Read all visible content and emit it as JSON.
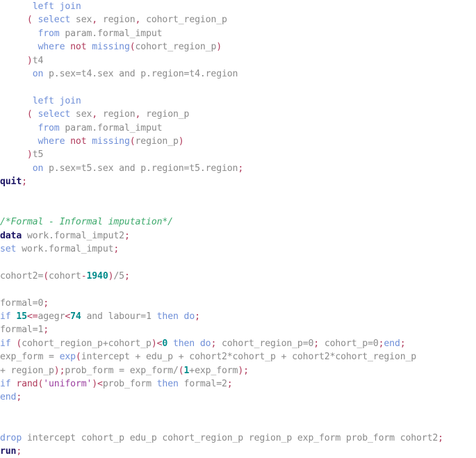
{
  "document": {
    "kind": "sas-code-listing",
    "language": "SAS",
    "background_color": "#ffffff"
  },
  "palette": {
    "plain": "#8a8a8a",
    "keyword": "#6f8fd8",
    "procedure": "#1b1464",
    "punctuation": "#b03a5b",
    "string": "#9b3fa0",
    "number": "#008b8b",
    "comment": "#3faa6d"
  },
  "code": {
    "lines": [
      {
        "id": "l01",
        "indent": 6,
        "tokens": [
          {
            "t": "kw",
            "v": "left join"
          }
        ]
      },
      {
        "id": "l02",
        "indent": 5,
        "tokens": [
          {
            "t": "punc",
            "v": "("
          },
          {
            "t": "plain",
            "v": " "
          },
          {
            "t": "kw",
            "v": "select"
          },
          {
            "t": "plain",
            "v": " sex"
          },
          {
            "t": "punc",
            "v": ","
          },
          {
            "t": "plain",
            "v": " region"
          },
          {
            "t": "punc",
            "v": ","
          },
          {
            "t": "plain",
            "v": " cohort_region_p"
          }
        ]
      },
      {
        "id": "l03",
        "indent": 7,
        "tokens": [
          {
            "t": "kw",
            "v": "from"
          },
          {
            "t": "plain",
            "v": " param.formal_imput"
          }
        ]
      },
      {
        "id": "l04",
        "indent": 7,
        "tokens": [
          {
            "t": "kw",
            "v": "where"
          },
          {
            "t": "plain",
            "v": " "
          },
          {
            "t": "func",
            "v": "not"
          },
          {
            "t": "plain",
            "v": " "
          },
          {
            "t": "kw",
            "v": "missing"
          },
          {
            "t": "punc",
            "v": "("
          },
          {
            "t": "plain",
            "v": "cohort_region_p"
          },
          {
            "t": "punc",
            "v": ")"
          }
        ]
      },
      {
        "id": "l05",
        "indent": 5,
        "tokens": [
          {
            "t": "punc",
            "v": ")"
          },
          {
            "t": "plain",
            "v": "t4"
          }
        ]
      },
      {
        "id": "l06",
        "indent": 6,
        "tokens": [
          {
            "t": "kw",
            "v": "on"
          },
          {
            "t": "plain",
            "v": " p.sex=t4.sex and p.region=t4.region"
          }
        ]
      },
      {
        "id": "l07",
        "indent": 0,
        "tokens": []
      },
      {
        "id": "l08",
        "indent": 6,
        "tokens": [
          {
            "t": "kw",
            "v": "left join"
          }
        ]
      },
      {
        "id": "l09",
        "indent": 5,
        "tokens": [
          {
            "t": "punc",
            "v": "("
          },
          {
            "t": "plain",
            "v": " "
          },
          {
            "t": "kw",
            "v": "select"
          },
          {
            "t": "plain",
            "v": " sex"
          },
          {
            "t": "punc",
            "v": ","
          },
          {
            "t": "plain",
            "v": " region"
          },
          {
            "t": "punc",
            "v": ","
          },
          {
            "t": "plain",
            "v": " region_p"
          }
        ]
      },
      {
        "id": "l10",
        "indent": 7,
        "tokens": [
          {
            "t": "kw",
            "v": "from"
          },
          {
            "t": "plain",
            "v": " param.formal_imput"
          }
        ]
      },
      {
        "id": "l11",
        "indent": 7,
        "tokens": [
          {
            "t": "kw",
            "v": "where"
          },
          {
            "t": "plain",
            "v": " "
          },
          {
            "t": "func",
            "v": "not"
          },
          {
            "t": "plain",
            "v": " "
          },
          {
            "t": "kw",
            "v": "missing"
          },
          {
            "t": "punc",
            "v": "("
          },
          {
            "t": "plain",
            "v": "region_p"
          },
          {
            "t": "punc",
            "v": ")"
          }
        ]
      },
      {
        "id": "l12",
        "indent": 5,
        "tokens": [
          {
            "t": "punc",
            "v": ")"
          },
          {
            "t": "plain",
            "v": "t5"
          }
        ]
      },
      {
        "id": "l13",
        "indent": 6,
        "tokens": [
          {
            "t": "kw",
            "v": "on"
          },
          {
            "t": "plain",
            "v": " p.sex=t5.sex and p.region=t5.region"
          },
          {
            "t": "punc",
            "v": ";"
          }
        ]
      },
      {
        "id": "l14",
        "indent": 0,
        "tokens": [
          {
            "t": "proc",
            "v": "quit"
          },
          {
            "t": "punc",
            "v": ";"
          }
        ]
      },
      {
        "id": "l15",
        "indent": 0,
        "tokens": []
      },
      {
        "id": "l16",
        "indent": 0,
        "tokens": []
      },
      {
        "id": "l17",
        "indent": 0,
        "tokens": [
          {
            "t": "cmt",
            "v": "/*Formal - Informal imputation*/"
          }
        ]
      },
      {
        "id": "l18",
        "indent": 0,
        "tokens": [
          {
            "t": "proc",
            "v": "data"
          },
          {
            "t": "plain",
            "v": " work.formal_imput2"
          },
          {
            "t": "punc",
            "v": ";"
          }
        ]
      },
      {
        "id": "l19",
        "indent": 0,
        "tokens": [
          {
            "t": "kw",
            "v": "set"
          },
          {
            "t": "plain",
            "v": " work.formal_imput"
          },
          {
            "t": "punc",
            "v": ";"
          }
        ]
      },
      {
        "id": "l20",
        "indent": 0,
        "tokens": []
      },
      {
        "id": "l21",
        "indent": 0,
        "tokens": [
          {
            "t": "plain",
            "v": "cohort2="
          },
          {
            "t": "punc",
            "v": "("
          },
          {
            "t": "plain",
            "v": "cohort"
          },
          {
            "t": "punc",
            "v": "-"
          },
          {
            "t": "num",
            "v": "1940"
          },
          {
            "t": "punc",
            "v": ")"
          },
          {
            "t": "plain",
            "v": "/5"
          },
          {
            "t": "punc",
            "v": ";"
          }
        ]
      },
      {
        "id": "l22",
        "indent": 0,
        "tokens": []
      },
      {
        "id": "l23",
        "indent": 0,
        "tokens": [
          {
            "t": "plain",
            "v": "formal=0"
          },
          {
            "t": "punc",
            "v": ";"
          }
        ]
      },
      {
        "id": "l24",
        "indent": 0,
        "tokens": [
          {
            "t": "kw",
            "v": "if"
          },
          {
            "t": "plain",
            "v": " "
          },
          {
            "t": "num",
            "v": "15"
          },
          {
            "t": "punc",
            "v": "<="
          },
          {
            "t": "plain",
            "v": "agegr"
          },
          {
            "t": "punc",
            "v": "<"
          },
          {
            "t": "num",
            "v": "74"
          },
          {
            "t": "plain",
            "v": " and labour=1 "
          },
          {
            "t": "kw",
            "v": "then"
          },
          {
            "t": "plain",
            "v": " "
          },
          {
            "t": "kw",
            "v": "do"
          },
          {
            "t": "punc",
            "v": ";"
          }
        ]
      },
      {
        "id": "l25",
        "indent": 0,
        "tokens": [
          {
            "t": "plain",
            "v": "formal=1"
          },
          {
            "t": "punc",
            "v": ";"
          }
        ]
      },
      {
        "id": "l26",
        "indent": 0,
        "tokens": [
          {
            "t": "kw",
            "v": "if"
          },
          {
            "t": "plain",
            "v": " "
          },
          {
            "t": "punc",
            "v": "("
          },
          {
            "t": "plain",
            "v": "cohort_region_p+cohort_p"
          },
          {
            "t": "punc",
            "v": ")<"
          },
          {
            "t": "num",
            "v": "0"
          },
          {
            "t": "plain",
            "v": " "
          },
          {
            "t": "kw",
            "v": "then"
          },
          {
            "t": "plain",
            "v": " "
          },
          {
            "t": "kw",
            "v": "do"
          },
          {
            "t": "punc",
            "v": ";"
          },
          {
            "t": "plain",
            "v": " cohort_region_p=0"
          },
          {
            "t": "punc",
            "v": ";"
          },
          {
            "t": "plain",
            "v": " cohort_p=0"
          },
          {
            "t": "punc",
            "v": ";"
          },
          {
            "t": "kw",
            "v": "end"
          },
          {
            "t": "punc",
            "v": ";"
          }
        ]
      },
      {
        "id": "l27",
        "indent": 0,
        "tokens": [
          {
            "t": "plain",
            "v": "exp_form = "
          },
          {
            "t": "kw",
            "v": "exp"
          },
          {
            "t": "punc",
            "v": "("
          },
          {
            "t": "plain",
            "v": "intercept + edu_p + cohort2*cohort_p + cohort2*cohort_region_p"
          }
        ]
      },
      {
        "id": "l28",
        "indent": 0,
        "tokens": [
          {
            "t": "plain",
            "v": "+ region_p"
          },
          {
            "t": "punc",
            "v": ");"
          },
          {
            "t": "plain",
            "v": "prob_form = exp_form/"
          },
          {
            "t": "punc",
            "v": "("
          },
          {
            "t": "num",
            "v": "1"
          },
          {
            "t": "plain",
            "v": "+exp_form"
          },
          {
            "t": "punc",
            "v": ");"
          }
        ]
      },
      {
        "id": "l29",
        "indent": 0,
        "tokens": [
          {
            "t": "kw",
            "v": "if"
          },
          {
            "t": "plain",
            "v": " "
          },
          {
            "t": "func",
            "v": "rand"
          },
          {
            "t": "punc",
            "v": "("
          },
          {
            "t": "str",
            "v": "'uniform'"
          },
          {
            "t": "punc",
            "v": ")<"
          },
          {
            "t": "plain",
            "v": "prob_form "
          },
          {
            "t": "kw",
            "v": "then"
          },
          {
            "t": "plain",
            "v": " formal=2"
          },
          {
            "t": "punc",
            "v": ";"
          }
        ]
      },
      {
        "id": "l30",
        "indent": 0,
        "tokens": [
          {
            "t": "kw",
            "v": "end"
          },
          {
            "t": "punc",
            "v": ";"
          }
        ]
      },
      {
        "id": "l31",
        "indent": 0,
        "tokens": []
      },
      {
        "id": "l32",
        "indent": 0,
        "tokens": []
      },
      {
        "id": "l33",
        "indent": 0,
        "tokens": [
          {
            "t": "kw",
            "v": "drop"
          },
          {
            "t": "plain",
            "v": " intercept cohort_p edu_p cohort_region_p region_p exp_form prob_form cohort2"
          },
          {
            "t": "punc",
            "v": ";"
          }
        ]
      },
      {
        "id": "l34",
        "indent": 0,
        "tokens": [
          {
            "t": "proc",
            "v": "run"
          },
          {
            "t": "punc",
            "v": ";"
          }
        ]
      }
    ]
  }
}
